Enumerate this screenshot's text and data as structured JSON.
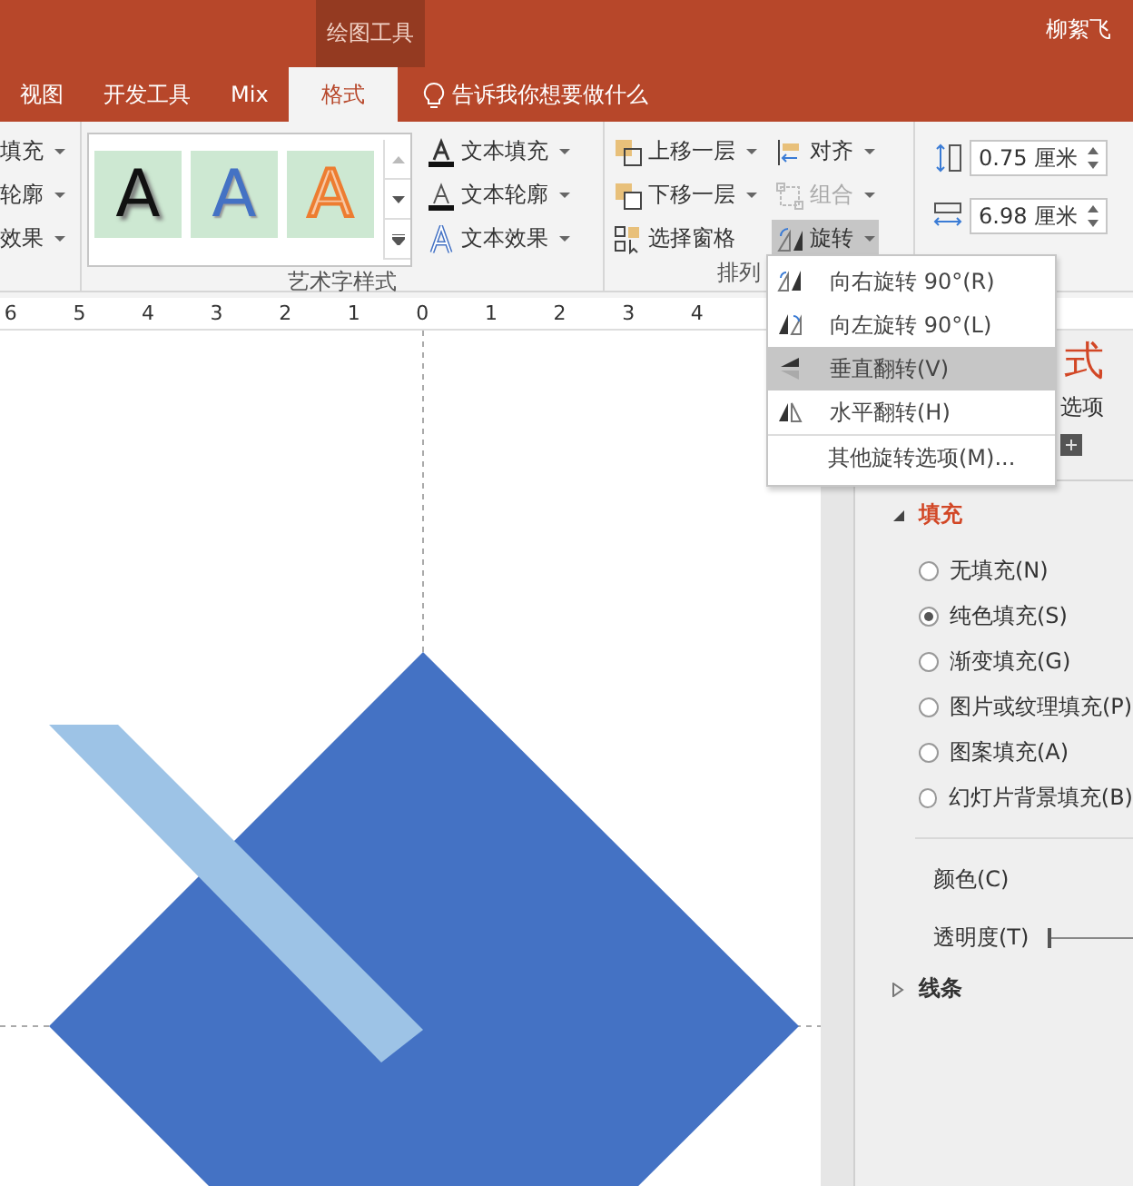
{
  "title_bar": {
    "context_tab": "绘图工具",
    "user": "柳絮飞"
  },
  "tabs": [
    {
      "label": "视图",
      "selected": false
    },
    {
      "label": "开发工具",
      "selected": false
    },
    {
      "label": "Mix",
      "selected": false
    },
    {
      "label": "格式",
      "selected": true
    }
  ],
  "tell_me": {
    "placeholder": "告诉我你想要做什么"
  },
  "shape_group": {
    "items": [
      {
        "label": "填充"
      },
      {
        "label": "轮廓"
      },
      {
        "label": "效果"
      }
    ]
  },
  "wordart_group": {
    "label": "艺术字样式",
    "styles": [
      {
        "letter": "A",
        "kind": "shadow"
      },
      {
        "letter": "A",
        "kind": "blue"
      },
      {
        "letter": "A",
        "kind": "orange"
      }
    ],
    "buttons": [
      {
        "label": "文本填充",
        "kind": "fill"
      },
      {
        "label": "文本轮廓",
        "kind": "outline"
      },
      {
        "label": "文本效果",
        "kind": "effect"
      }
    ]
  },
  "arrange_group": {
    "label": "排列",
    "items": [
      {
        "label": "上移一层",
        "kind": "forward",
        "has_menu": true,
        "disabled": false,
        "pressed": false
      },
      {
        "label": "下移一层",
        "kind": "backward",
        "has_menu": true,
        "disabled": false,
        "pressed": false
      },
      {
        "label": "选择窗格",
        "kind": "pane",
        "has_menu": false,
        "disabled": false,
        "pressed": false
      },
      {
        "label": "对齐",
        "kind": "align",
        "has_menu": true,
        "disabled": false,
        "pressed": false
      },
      {
        "label": "组合",
        "kind": "group",
        "has_menu": true,
        "disabled": true,
        "pressed": false
      },
      {
        "label": "旋转",
        "kind": "rotate",
        "has_menu": true,
        "disabled": false,
        "pressed": true
      }
    ]
  },
  "size_group": {
    "fields": [
      {
        "value": "0.75 厘米",
        "kind": "height"
      },
      {
        "value": "6.98 厘米",
        "kind": "width"
      }
    ]
  },
  "ruler": {
    "labels": [
      "6",
      "5",
      "4",
      "3",
      "2",
      "1",
      "0",
      "1",
      "2",
      "3",
      "4"
    ]
  },
  "rotate_menu": {
    "items": [
      {
        "label": "向右旋转 90°(R)",
        "kind": "rotate-right",
        "selected": false
      },
      {
        "label": "向左旋转 90°(L)",
        "kind": "rotate-left",
        "selected": false
      },
      {
        "label": "垂直翻转(V)",
        "kind": "flip-vertical",
        "selected": true
      },
      {
        "label": "水平翻转(H)",
        "kind": "flip-horizontal",
        "selected": false
      },
      {
        "label": "其他旋转选项(M)...",
        "kind": "more",
        "selected": false
      }
    ]
  },
  "format_pane": {
    "title": "式",
    "subtitle": "选项",
    "sections": [
      {
        "label": "填充",
        "expanded": true,
        "options": [
          {
            "label": "无填充(N)",
            "selected": false
          },
          {
            "label": "纯色填充(S)",
            "selected": true
          },
          {
            "label": "渐变填充(G)",
            "selected": false
          },
          {
            "label": "图片或纹理填充(P)",
            "selected": false
          },
          {
            "label": "图案填充(A)",
            "selected": false
          },
          {
            "label": "幻灯片背景填充(B)",
            "selected": false
          }
        ],
        "properties": [
          {
            "label": "颜色(C)",
            "kind": "color"
          },
          {
            "label": "透明度(T)",
            "kind": "slider",
            "level": 0
          }
        ]
      },
      {
        "label": "线条",
        "expanded": false
      }
    ]
  }
}
